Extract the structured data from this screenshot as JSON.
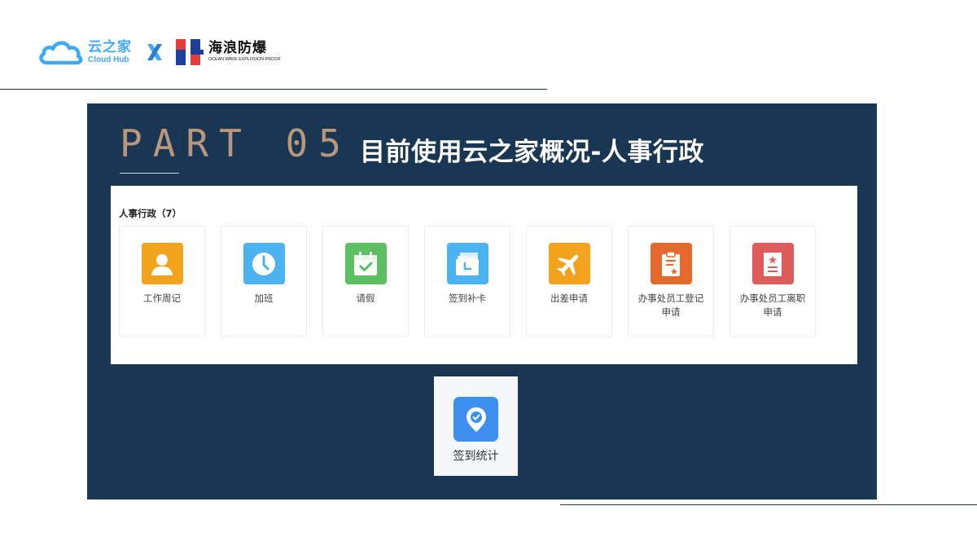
{
  "header": {
    "cloudhub_cn": "云之家",
    "cloudhub_en": "Cloud Hub",
    "partner_cn": "海浪防爆",
    "partner_en": "OCEAN WAVE EXPLOSION-PROOF"
  },
  "slide": {
    "part_label": "PART 05",
    "title": "目前使用云之家概况-人事行政"
  },
  "apps": {
    "section_title": "人事行政（7）",
    "items": [
      {
        "label": "工作周记",
        "icon": "person-icon",
        "color": "#f3a21c"
      },
      {
        "label": "加班",
        "icon": "clock-icon",
        "color": "#4bb3f2"
      },
      {
        "label": "请假",
        "icon": "calendar-check-icon",
        "color": "#5cc063"
      },
      {
        "label": "签到补卡",
        "icon": "card-clock-icon",
        "color": "#4bb3f2"
      },
      {
        "label": "出差申请",
        "icon": "airplane-icon",
        "color": "#f3a21c"
      },
      {
        "label": "办事处员工登记申请",
        "icon": "clipboard-star-icon",
        "color": "#e5692c"
      },
      {
        "label": "办事处员工离职申请",
        "icon": "document-star-icon",
        "color": "#e05b5b"
      }
    ]
  },
  "stat": {
    "label": "签到统计",
    "icon": "location-check-icon",
    "color": "#3d8ff0"
  },
  "colors": {
    "panel_bg": "#193652",
    "accent_gold": "#b8977a",
    "cloudhub_blue": "#3fa9f5"
  }
}
